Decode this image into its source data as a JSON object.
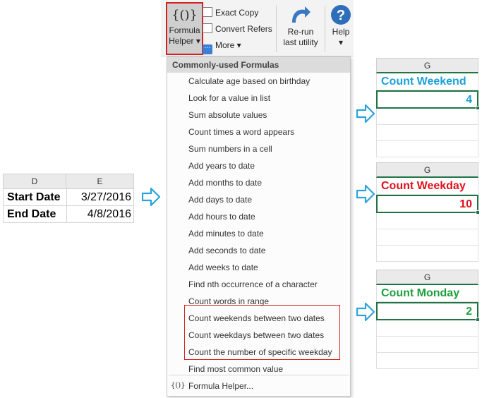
{
  "ribbon": {
    "formula_helper_glyph": "{()}",
    "formula_helper_label_1": "Formula",
    "formula_helper_label_2": "Helper ▾",
    "exact_copy": "Exact Copy",
    "convert_refers": "Convert Refers",
    "more": "More ▾",
    "rerun_label_1": "Re-run",
    "rerun_label_2": "last utility",
    "help_label": "Help",
    "help_caret": "▾"
  },
  "menu": {
    "header": "Commonly-used Formulas",
    "items": [
      "Calculate age based on birthday",
      "Look for a value in list",
      "Sum absolute values",
      "Count times a word appears",
      "Sum numbers in a cell",
      "Add years to date",
      "Add months to date",
      "Add days to date",
      "Add hours to date",
      "Add minutes to date",
      "Add seconds to date",
      "Add weeks to date",
      "Find nth occurrence of a character",
      "Count words in range",
      "Count weekends between two dates",
      "Count weekdays between two dates",
      "Count the number of specific weekday",
      "Find most common value"
    ],
    "footer_icon": "{()}",
    "footer_label": "Formula Helper..."
  },
  "sheet_de": {
    "col_d": "D",
    "col_e": "E",
    "rows": [
      {
        "label": "Start Date",
        "value": "3/27/2016"
      },
      {
        "label": "End Date",
        "value": "4/8/2016"
      }
    ]
  },
  "panels": [
    {
      "col": "G",
      "title": "Count Weekend",
      "value": "4",
      "color": "#1aa0d8"
    },
    {
      "col": "G",
      "title": "Count Weekday",
      "value": "10",
      "color": "#e0111b"
    },
    {
      "col": "G",
      "title": "Count Monday",
      "value": "2",
      "color": "#1e9e3e"
    }
  ],
  "colors": {
    "highlight_border": "#d6201f",
    "arrow": "#2ba3d9",
    "excel_green": "#217346"
  }
}
